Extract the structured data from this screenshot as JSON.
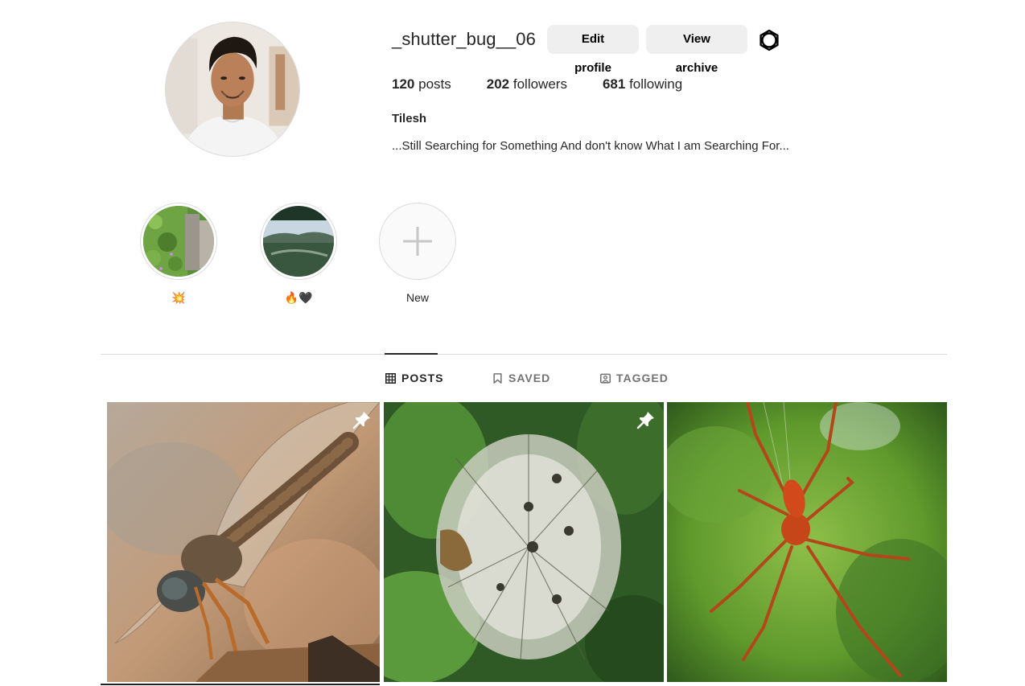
{
  "profile": {
    "username": "_shutter_bug__06",
    "edit_label": "Edit profile",
    "archive_label": "View archive",
    "posts_count": "120",
    "posts_label": "posts",
    "followers_count": "202",
    "followers_label": "followers",
    "following_count": "681",
    "following_label": "following",
    "full_name": "Tilesh",
    "bio": "...Still Searching for Something And don't know What I am Searching For..."
  },
  "highlights": [
    {
      "label": "💥",
      "icon": "garden-thumbnail"
    },
    {
      "label": "🔥🖤",
      "icon": "landscape-thumbnail"
    },
    {
      "label": "New",
      "icon": "plus-icon"
    }
  ],
  "tabs": [
    {
      "label": "POSTS",
      "icon": "grid-icon",
      "active": true
    },
    {
      "label": "SAVED",
      "icon": "bookmark-icon",
      "active": false
    },
    {
      "label": "TAGGED",
      "icon": "tagged-icon",
      "active": false
    }
  ],
  "posts": [
    {
      "subject": "dragonfly",
      "pinned": true
    },
    {
      "subject": "dandelion-seed-head",
      "pinned": true
    },
    {
      "subject": "orange-spider",
      "pinned": false
    }
  ],
  "colors": {
    "button_bg": "#efefef",
    "divider": "#dbdbdb",
    "text": "#262626",
    "muted": "#737373"
  }
}
